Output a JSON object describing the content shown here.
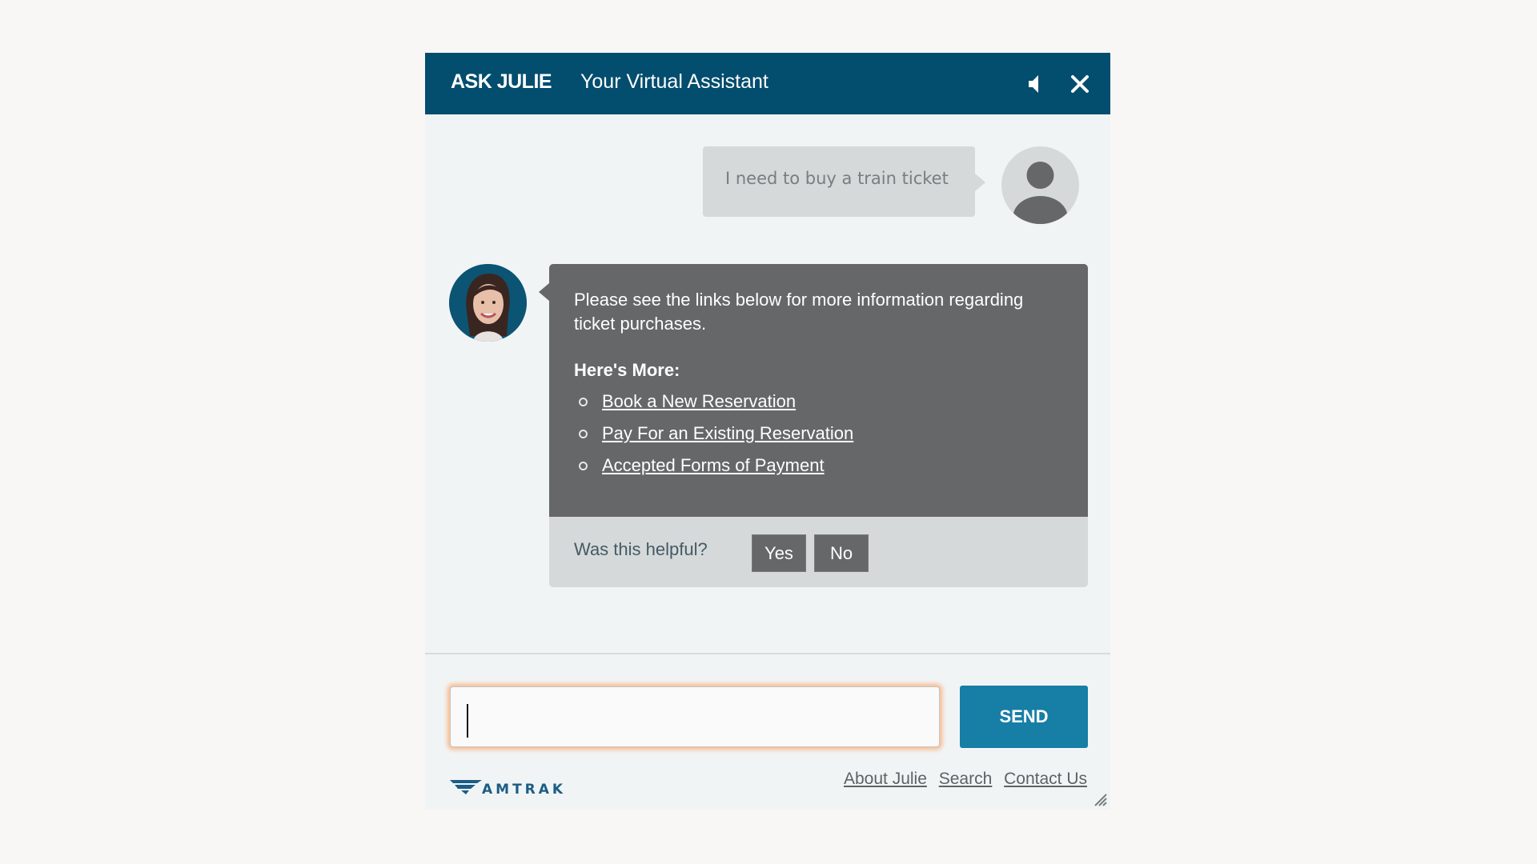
{
  "header": {
    "brand": "ASK JULIE",
    "subtitle": "Your Virtual Assistant",
    "icons": {
      "mute": "speaker-icon",
      "close": "close-icon"
    }
  },
  "conversation": {
    "user_message": "I need to buy a train ticket",
    "bot_message": "Please see the links below for more information regarding ticket purchases.",
    "more_title": "Here's More:",
    "links": [
      "Book a New Reservation",
      "Pay For an Existing Reservation",
      "Accepted Forms of Payment"
    ],
    "feedback": {
      "label": "Was this helpful?",
      "yes": "Yes",
      "no": "No"
    }
  },
  "composer": {
    "value": "",
    "send_label": "SEND"
  },
  "footer": {
    "logo_text": "AMTRAK",
    "links": [
      "About Julie",
      "Search",
      "Contact Us"
    ]
  },
  "colors": {
    "header": "#034d6e",
    "send": "#177ea6",
    "bot_bubble": "#666769",
    "user_bubble": "#d5d9da",
    "focus_glow": "#f8b88a"
  }
}
